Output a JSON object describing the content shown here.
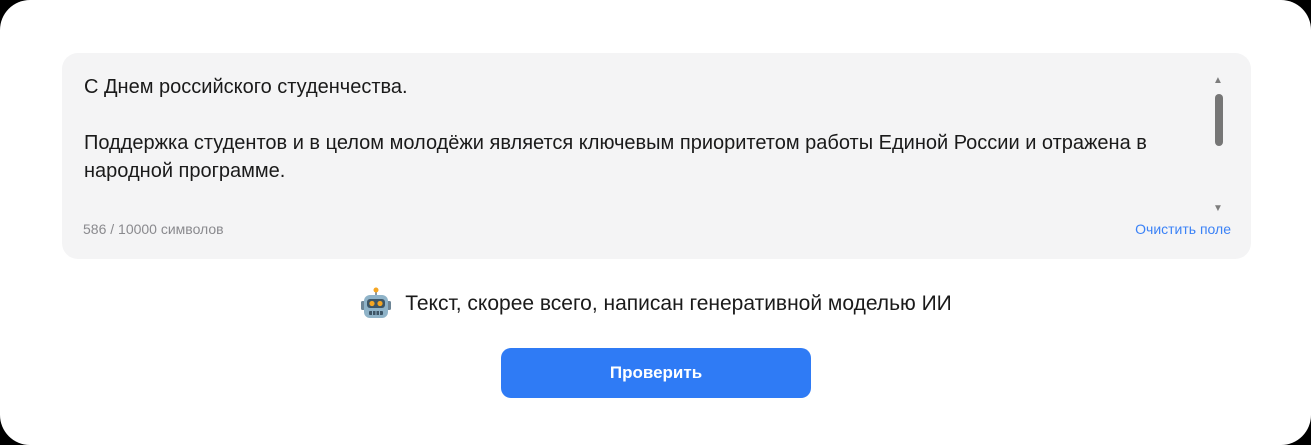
{
  "editor": {
    "paragraphs": [
      "С Днем российского студенчества.",
      "Поддержка студентов и в целом молодёжи является ключевым приоритетом работы Единой России и отражена в народной программе.",
      ""
    ],
    "char_counter": "586 / 10000 символов",
    "clear_label": "Очистить поле"
  },
  "result": {
    "icon": "robot-face-icon",
    "text": "Текст, скорее всего, написан генеративной моделью ИИ"
  },
  "actions": {
    "check_label": "Проверить",
    "check_color": "#2f7bf5"
  },
  "colors": {
    "card_background": "#f4f4f5",
    "link": "#3b82f6"
  }
}
